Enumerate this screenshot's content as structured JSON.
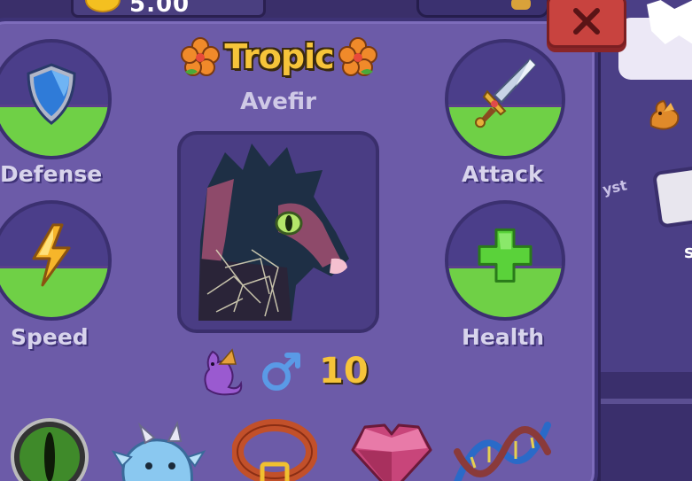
{
  "top_bar": {
    "currency_value": "5.00"
  },
  "dragon": {
    "name": "Tropic",
    "species": "Avefir",
    "gender_symbol": "♂",
    "level": "10"
  },
  "stats": {
    "defense": {
      "label": "Defense",
      "icon": "shield-icon",
      "fill_fraction": 0.45
    },
    "attack": {
      "label": "Attack",
      "icon": "sword-icon",
      "fill_fraction": 0.45
    },
    "speed": {
      "label": "Speed",
      "icon": "lightning-icon",
      "fill_fraction": 0.45
    },
    "health": {
      "label": "Health",
      "icon": "plus-icon",
      "fill_fraction": 0.45
    }
  },
  "side_panel": {
    "partial_text": "yst",
    "partial_letter": "s"
  },
  "bottom_items": [
    {
      "icon": "eye-icon"
    },
    {
      "icon": "baby-dragon-icon"
    },
    {
      "icon": "collar-icon"
    },
    {
      "icon": "gem-heart-icon"
    },
    {
      "icon": "dna-icon"
    }
  ],
  "colors": {
    "panel": "#6c5ba8",
    "fill_green": "#6fd046",
    "title_gold": "#f6c43a",
    "close_red": "#c8433f"
  }
}
